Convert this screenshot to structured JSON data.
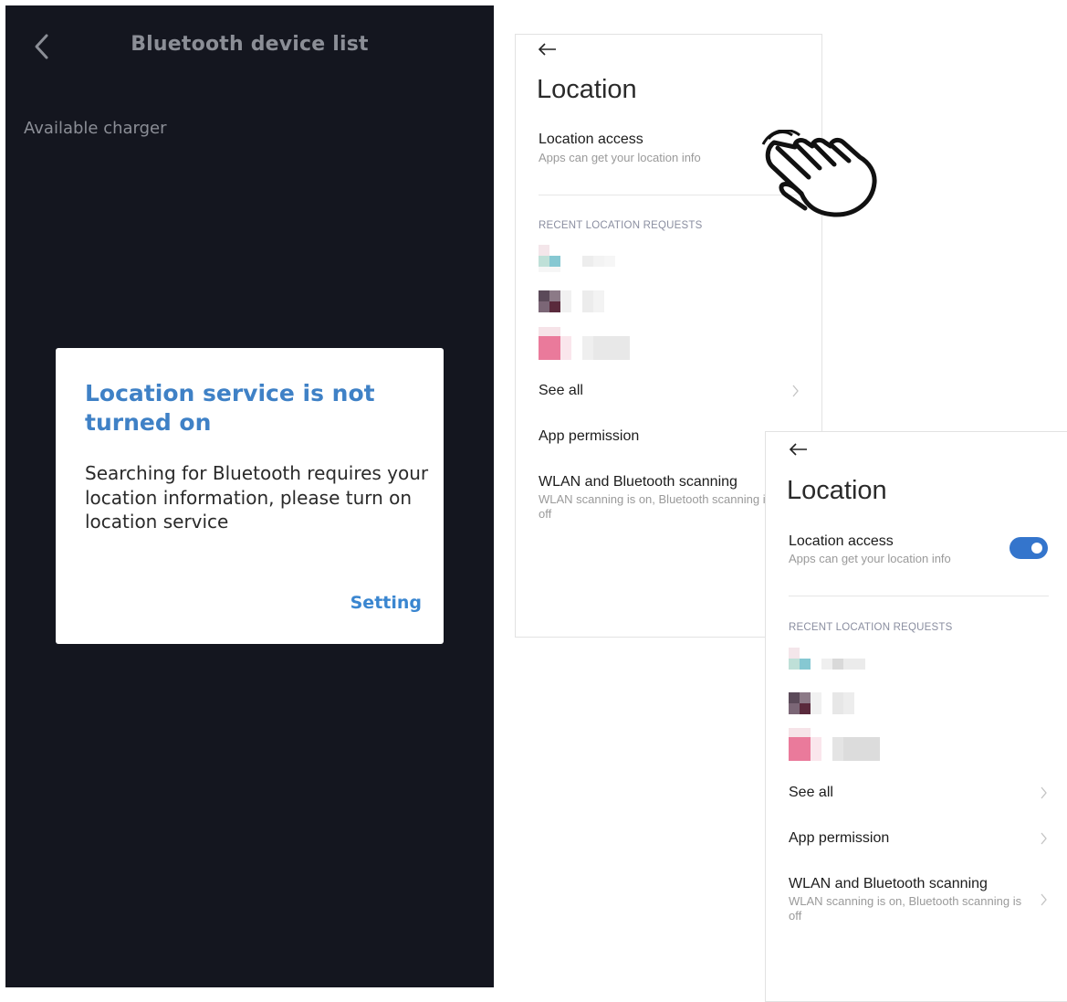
{
  "left_screen": {
    "title": "Bluetooth device list",
    "section_label": "Available charger",
    "back_icon": "chevron-left-icon",
    "dialog": {
      "title": "Location service is not turned on",
      "message": "Searching for Bluetooth requires your location information, please turn on location service",
      "button": "Setting"
    }
  },
  "location_before": {
    "back_icon": "arrow-left-icon",
    "title": "Location",
    "location_access": {
      "title": "Location access",
      "subtitle": "Apps can get your location info",
      "toggle_on": false
    },
    "recent_header": "RECENT LOCATION REQUESTS",
    "see_all": "See all",
    "app_permission": "App permission",
    "wlan": {
      "title": "WLAN and Bluetooth scanning",
      "subtitle": "WLAN scanning is on, Bluetooth scanning is off"
    }
  },
  "location_after": {
    "back_icon": "arrow-left-icon",
    "title": "Location",
    "location_access": {
      "title": "Location access",
      "subtitle": "Apps can get your location info",
      "toggle_on": true
    },
    "recent_header": "RECENT LOCATION REQUESTS",
    "see_all": "See all",
    "app_permission": "App permission",
    "wlan": {
      "title": "WLAN and Bluetooth scanning",
      "subtitle": "WLAN scanning is on, Bluetooth scanning is off"
    }
  },
  "hand_icon": "tap-hand-icon",
  "colors": {
    "dark_bg": "#14161f",
    "dialog_accent": "#3f81c6",
    "toggle_on": "#3475cc"
  }
}
